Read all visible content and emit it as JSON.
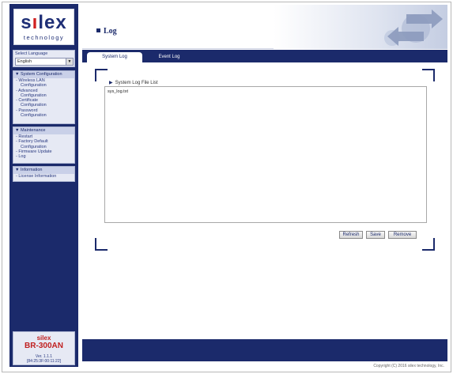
{
  "brand": {
    "logo": "silex",
    "tagline": "technology"
  },
  "language": {
    "label": "Select Language",
    "selected": "English"
  },
  "nav": [
    {
      "header": "▼ System Configuration",
      "items": [
        {
          "label": "- Wireless LAN",
          "sub": false
        },
        {
          "label": "Configuration",
          "sub": true
        },
        {
          "label": "- Advanced",
          "sub": false
        },
        {
          "label": "Configuration",
          "sub": true
        },
        {
          "label": "- Certificate",
          "sub": false
        },
        {
          "label": "Configuration",
          "sub": true
        },
        {
          "label": "- Password",
          "sub": false
        },
        {
          "label": "Configuration",
          "sub": true
        }
      ]
    },
    {
      "header": "▼ Maintenance",
      "items": [
        {
          "label": "- Restart",
          "sub": false
        },
        {
          "label": "- Factory Default",
          "sub": false
        },
        {
          "label": "Configuration",
          "sub": true
        },
        {
          "label": "- Firmware Update",
          "sub": false
        },
        {
          "label": "- Log",
          "sub": false
        }
      ]
    },
    {
      "header": "▼ Information",
      "items": [
        {
          "label": "- License Information",
          "sub": false
        }
      ]
    }
  ],
  "device": {
    "brand": "silex",
    "model": "BR-300AN",
    "version": "Ver. 1.1.1",
    "mac": "[84:25:3F:00:11:22]"
  },
  "page": {
    "title": "Log"
  },
  "tabs": {
    "system": "System Log",
    "event": "Event Log"
  },
  "log": {
    "list_title": "System Log File List",
    "files": [
      "sys_log.txt"
    ]
  },
  "buttons": {
    "refresh": "Refresh",
    "save": "Save",
    "remove": "Remove"
  },
  "footer": {
    "copyright": "Copyright (C) 2016 silex technology, Inc."
  },
  "colors": {
    "primary": "#1b2a6b",
    "accent": "#d02020"
  }
}
